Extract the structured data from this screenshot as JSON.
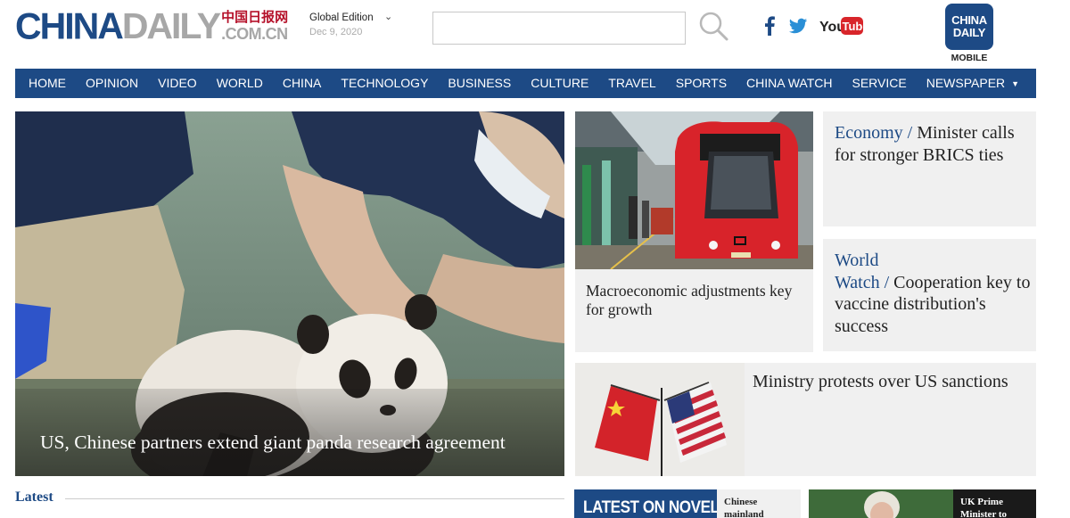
{
  "brand": {
    "wordmark_a": "CHINA",
    "wordmark_b": "DAILY",
    "wordmark_cn": "中国日报网",
    "wordmark_domain": ".COM.CN"
  },
  "header": {
    "edition": "Global Edition",
    "date": "Dec 9, 2020",
    "search": {
      "value": "",
      "placeholder": ""
    },
    "mobile_badge_line1": "CHINA",
    "mobile_badge_line2": "DAILY",
    "mobile_label": "MOBILE",
    "social": {
      "youtube_text_a": "You",
      "youtube_text_b": "Tube"
    }
  },
  "nav": {
    "items": [
      "HOME",
      "OPINION",
      "VIDEO",
      "WORLD",
      "CHINA",
      "TECHNOLOGY",
      "BUSINESS",
      "CULTURE",
      "TRAVEL",
      "SPORTS",
      "CHINA WATCH",
      "SERVICE",
      "NEWSPAPER"
    ]
  },
  "hero": {
    "title": "US, Chinese partners extend giant panda research agreement"
  },
  "cards": {
    "tram": {
      "title": "Macroeconomic adjustments key for growth"
    },
    "economy": {
      "section": "Economy",
      "title": "Minister calls for stronger BRICS ties"
    },
    "world_watch": {
      "section_line1": "World",
      "section_line2": "Watch",
      "title": "Cooperation key to vaccine distribution's success"
    },
    "ministry": {
      "title": "Ministry protests over US sanctions"
    }
  },
  "latest": {
    "heading": "Latest",
    "items": [
      {
        "banner": "LATEST ON NOVEL",
        "title_line1": "Chinese",
        "title_line2": "mainland"
      },
      {
        "title_line1": "UK Prime",
        "title_line2": "Minister to meet"
      }
    ]
  },
  "colors": {
    "brand_blue": "#1d4a85",
    "brand_gray": "#a7a7a7",
    "brand_red": "#b5112a",
    "card_bg": "#f0f0f0"
  }
}
